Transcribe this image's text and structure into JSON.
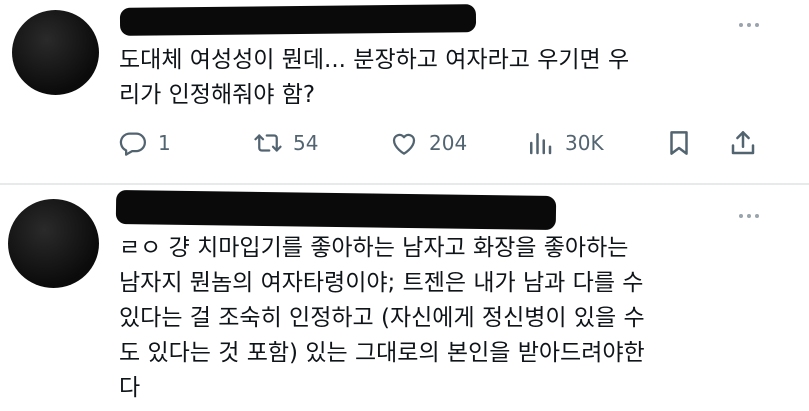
{
  "posts": [
    {
      "text": "도대체 여성성이 뭔데... 분장하고 여자라고 우기면 우\n리가 인정해줘야 함?",
      "stats": {
        "replies": "1",
        "reposts": "54",
        "likes": "204",
        "views": "30K"
      }
    },
    {
      "text": "ㄹㅇ 걍 치마입기를 좋아하는 남자고 화장을 좋아하는\n남자지 뭔놈의 여자타령이야; 트젠은 내가 남과 다를 수\n있다는 걸 조숙히 인정하고 (자신에게 정신병이 있을 수\n도 있다는 것 포함) 있는 그대로의 본인을 받아드려야한\n다"
    }
  ],
  "icons": {
    "reply": "reply-icon",
    "repost": "repost-icon",
    "like": "heart-icon",
    "views": "views-icon",
    "bookmark": "bookmark-icon",
    "share": "share-icon",
    "more": "more-icon"
  },
  "colors": {
    "text": "#0f1419",
    "muted": "#536471",
    "divider": "#e7e9ea",
    "redaction": "#0a0a0a"
  }
}
